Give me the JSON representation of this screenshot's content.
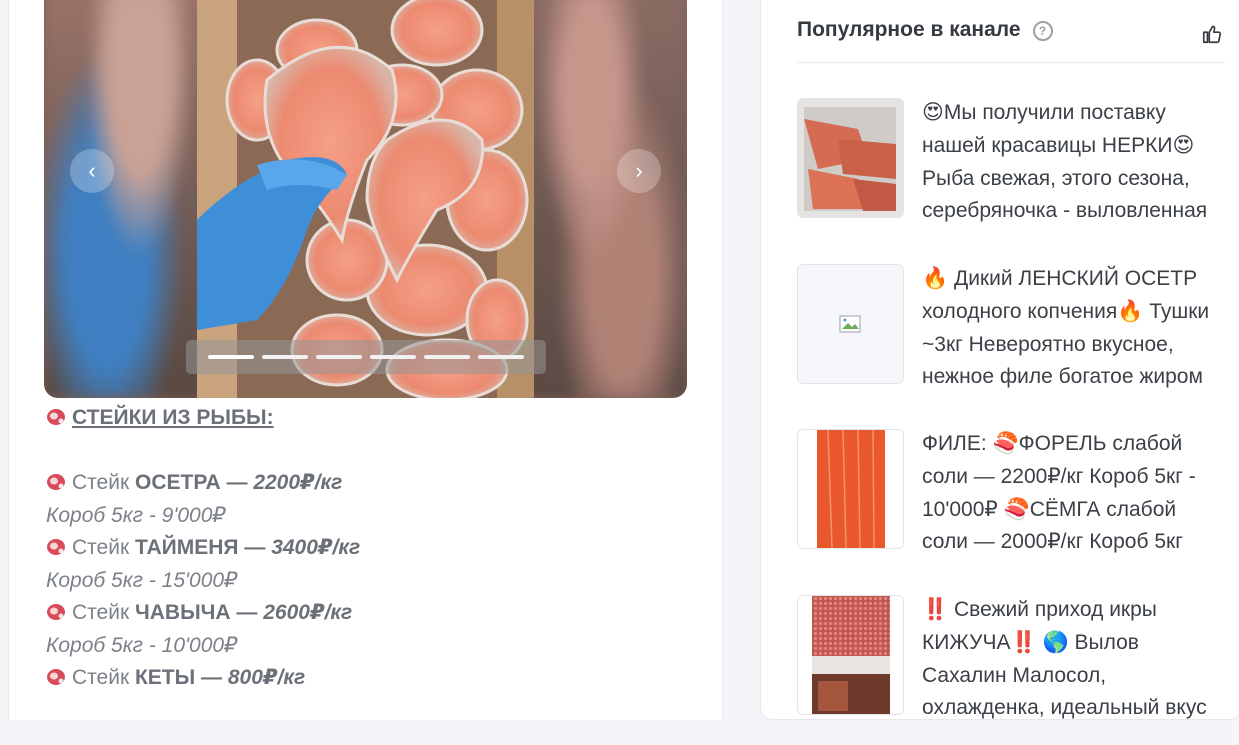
{
  "post": {
    "gallery": {
      "prev_icon": "chevron-left-icon",
      "next_icon": "chevron-right-icon",
      "dots_count": 6,
      "active_dot": 0
    },
    "heading": "СТЕЙКИ ИЗ РЫБЫ:",
    "items": [
      {
        "prefix": "Стейк ",
        "name": "ОСЕТРА",
        "sep": " — ",
        "price": "2200₽/кг",
        "box": "Короб 5кг - 9'000₽"
      },
      {
        "prefix": "Стейк ",
        "name": "ТАЙМЕНЯ",
        "sep": " — ",
        "price": "3400₽/кг",
        "box": "Короб 5кг - 15'000₽"
      },
      {
        "prefix": "Стейк ",
        "name": "ЧАВЫЧА",
        "sep": " — ",
        "price": "2600₽/кг",
        "box": "Короб 5кг - 10'000₽"
      },
      {
        "prefix": "Стейк ",
        "name": "КЕТЫ",
        "sep": " — ",
        "price": "800₽/кг",
        "box": ""
      }
    ]
  },
  "sidebar": {
    "title": "Популярное в канале",
    "help_icon": "question-circle-icon",
    "help_label": "?",
    "like_icon": "thumbs-up-icon",
    "items": [
      {
        "text": "😍Мы получили поставку нашей красавицы НЕРКИ😍 Рыба свежая, этого сезона, серебряночка - выловленная",
        "thumb": "red-fish-fillets"
      },
      {
        "text": "🔥 Дикий ЛЕНСКИЙ ОСЕТР холодного копчения🔥  Тушки ~3кг Невероятно вкусное, нежное филе богатое жиром",
        "thumb": "broken-image-icon"
      },
      {
        "text": "ФИЛЕ: 🍣ФОРЕЛЬ слабой соли — 2200₽/кг Короб 5кг - 10'000₽ 🍣СЁМГА слабой соли — 2000₽/кг Короб 5кг",
        "thumb": "trout-fillet"
      },
      {
        "text": "‼️ Свежий приход икры КИЖУЧА‼️  🌎 Вылов Сахалин Малосол, охлажденка, идеальный вкус",
        "thumb": "red-caviar-tray"
      }
    ]
  },
  "colors": {
    "background": "#f4f5f8",
    "card": "#ffffff",
    "text_muted": "#7c8189",
    "text_dark": "#343a40"
  }
}
